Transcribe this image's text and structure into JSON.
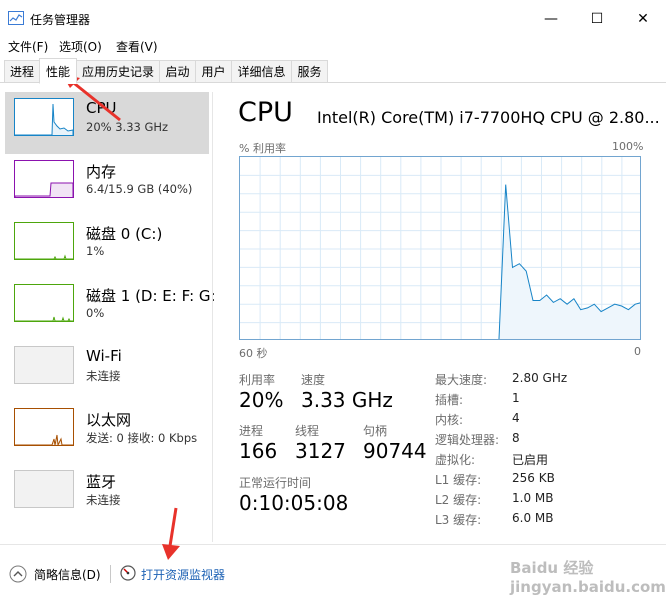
{
  "window": {
    "title": "任务管理器",
    "minimize": "—",
    "maximize": "☐",
    "close": "✕"
  },
  "menu": [
    "文件(F)",
    "选项(O)",
    "查看(V)"
  ],
  "tabs": [
    "进程",
    "性能",
    "应用历史记录",
    "启动",
    "用户",
    "详细信息",
    "服务"
  ],
  "active_tab": "性能",
  "sidebar": [
    {
      "name": "CPU",
      "value": "20%  3.33 GHz",
      "color": "#1784c7"
    },
    {
      "name": "内存",
      "value": "6.4/15.9 GB (40%)",
      "color": "#8b12ae"
    },
    {
      "name": "磁盘 0 (C:)",
      "value": "1%",
      "color": "#4da60c"
    },
    {
      "name": "磁盘 1 (D: E: F: G:",
      "value": "0%",
      "color": "#4da60c"
    },
    {
      "name": "Wi-Fi",
      "value": "未连接",
      "color": "#a0a0a0"
    },
    {
      "name": "以太网",
      "value": "发送: 0 接收: 0 Kbps",
      "color": "#a74f01"
    },
    {
      "name": "蓝牙",
      "value": "未连接",
      "color": "#a0a0a0"
    }
  ],
  "main": {
    "title": "CPU",
    "model": "Intel(R) Core(TM) i7-7700HQ CPU @ 2.80...",
    "graph_label": "% 利用率",
    "graph_max": "100%",
    "graph_time": "60 秒",
    "graph_min": "0",
    "utilization_label": "利用率",
    "utilization": "20%",
    "speed_label": "速度",
    "speed": "3.33 GHz",
    "processes_label": "进程",
    "processes": "166",
    "threads_label": "线程",
    "threads": "3127",
    "handles_label": "句柄",
    "handles": "90744",
    "uptime_label": "正常运行时间",
    "uptime": "0:10:05:08"
  },
  "details": [
    {
      "label": "最大速度:",
      "value": "2.80 GHz"
    },
    {
      "label": "插槽:",
      "value": "1"
    },
    {
      "label": "内核:",
      "value": "4"
    },
    {
      "label": "逻辑处理器:",
      "value": "8"
    },
    {
      "label": "虚拟化:",
      "value": "已启用"
    },
    {
      "label": "L1 缓存:",
      "value": "256 KB"
    },
    {
      "label": "L2 缓存:",
      "value": "1.0 MB"
    },
    {
      "label": "L3 缓存:",
      "value": "6.0 MB"
    }
  ],
  "footer": {
    "fewer_details": "简略信息(D)",
    "open_monitor": "打开资源监视器"
  },
  "watermark": "Baidu 经验 jingyan.baidu.com",
  "chart_data": {
    "type": "area",
    "ylim": [
      0,
      100
    ],
    "xlim": [
      60,
      0
    ],
    "values": [
      0,
      0,
      0,
      0,
      0,
      0,
      0,
      0,
      0,
      0,
      0,
      0,
      0,
      0,
      0,
      0,
      0,
      0,
      0,
      0,
      0,
      0,
      0,
      0,
      0,
      0,
      0,
      0,
      0,
      0,
      0,
      0,
      0,
      0,
      0,
      0,
      0,
      0,
      0,
      85,
      40,
      42,
      38,
      22,
      22,
      25,
      21,
      23,
      20,
      23,
      17,
      18,
      20,
      16,
      18,
      20,
      19,
      17,
      20,
      21
    ]
  }
}
